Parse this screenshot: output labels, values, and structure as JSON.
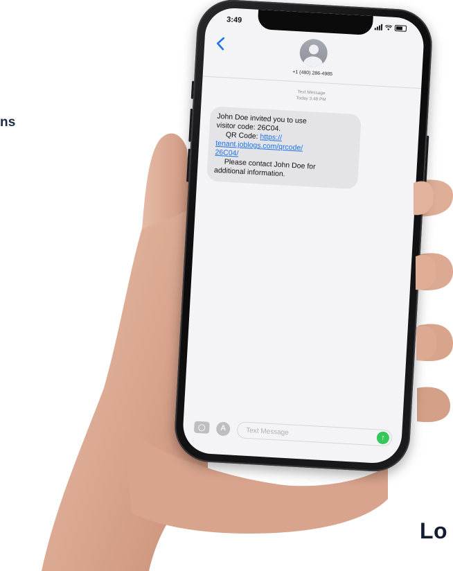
{
  "page": {
    "side_text": "ns",
    "brand_text": "Lo"
  },
  "phone": {
    "status_time": "3:49",
    "contact_number": "+1 (480) 286-4985",
    "meta_line1": "Text Message",
    "meta_line2": "Today 3:48 PM",
    "message": {
      "line1": "John Doe invited you to use",
      "line2": "visitor code: 26C04.",
      "qr_label": "QR Code: ",
      "link_part1": "https://",
      "link_part2": "tenant.joblogs.com/qrcode/",
      "link_part3": "26C04/",
      "line_contact": "Please contact John Doe for",
      "line_last": "additional information."
    },
    "composer_placeholder": "Text Message",
    "icons": {
      "back": "chevron-left-icon",
      "camera": "camera-icon",
      "apps": "app-store-icon",
      "send": "send-arrow-icon"
    },
    "colors": {
      "link": "#1a73e8",
      "send": "#34c759",
      "bubble": "#e4e4e8"
    }
  }
}
